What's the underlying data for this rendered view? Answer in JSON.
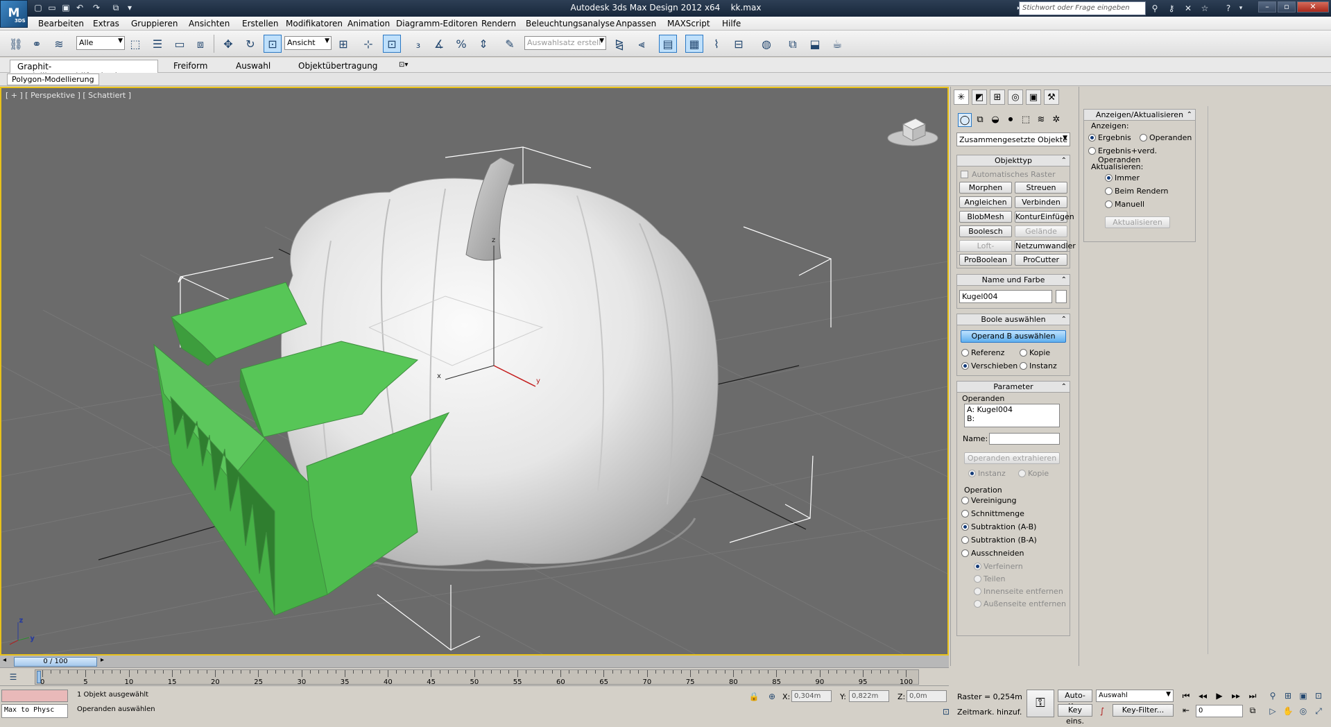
{
  "app": {
    "title": "Autodesk 3ds Max Design 2012 x64",
    "file": "kk.max",
    "logo_text": "M",
    "logo_sub": "3DS",
    "search_placeholder": "Stichwort oder Frage eingeben"
  },
  "menu": [
    "Bearbeiten",
    "Extras",
    "Gruppieren",
    "Ansichten",
    "Erstellen",
    "Modifikatoren",
    "Animation",
    "Diagramm-Editoren",
    "Beleuchtungsanalyse",
    "Rendern",
    "Anpassen",
    "MAXScript",
    "Hilfe"
  ],
  "toolbar": {
    "filter": "Alle",
    "refcoord": "Ansicht",
    "selset": "Auswahlsatz erstell"
  },
  "ribbon": {
    "tabs": [
      "Graphit-Modellierungshilfsmittel",
      "Freiform",
      "Auswahl",
      "Objektübertragung"
    ],
    "panel": "Polygon-Modellierung"
  },
  "viewport": {
    "label": "[ + ] [ Perspektive ] [ Schattiert ]",
    "axis_x": "x",
    "axis_y": "y",
    "axis_z": "z"
  },
  "cmd": {
    "category": "Zusammengesetzte Objekte",
    "objekttyp": {
      "title": "Objekttyp",
      "auto_grid": "Automatisches Raster",
      "buttons": [
        "Morphen",
        "Streuen",
        "Angleichen",
        "Verbinden",
        "BlobMesh",
        "KonturEinfügen",
        "Boolesch",
        "Gelände",
        "Loft-Extrusion",
        "Netzumwandler",
        "ProBoolean",
        "ProCutter"
      ]
    },
    "name_farbe": {
      "title": "Name und Farbe",
      "name": "Kugel004"
    },
    "boole": {
      "title": "Boole auswählen",
      "pick_button": "Operand B auswählen",
      "options": [
        "Referenz",
        "Kopie",
        "Verschieben",
        "Instanz"
      ]
    },
    "parameter": {
      "title": "Parameter",
      "operanden_label": "Operanden",
      "operand_a": "A: Kugel004",
      "operand_b": "B:",
      "name_label": "Name:",
      "extract_button": "Operanden extrahieren",
      "instanz": "Instanz",
      "kopie": "Kopie",
      "operation_label": "Operation",
      "operations": [
        "Vereinigung",
        "Schnittmenge",
        "Subtraktion (A-B)",
        "Subtraktion (B-A)",
        "Ausschneiden"
      ],
      "cut_options": [
        "Verfeinern",
        "Teilen",
        "Innenseite entfernen",
        "Außenseite entfernen"
      ]
    }
  },
  "display": {
    "title": "Anzeigen/Aktualisieren",
    "anzeigen": "Anzeigen:",
    "ergebnis": "Ergebnis",
    "operanden": "Operanden",
    "ergebnis_verd": "Ergebnis+verd. Operanden",
    "aktualisieren": "Aktualisieren:",
    "immer": "Immer",
    "beim_rendern": "Beim Rendern",
    "manuell": "Manuell",
    "update_button": "Aktualisieren"
  },
  "timeline": {
    "frame": "0 / 100",
    "ticks": [
      "0",
      "5",
      "10",
      "15",
      "20",
      "25",
      "30",
      "35",
      "40",
      "45",
      "50",
      "55",
      "60",
      "65",
      "70",
      "75",
      "80",
      "85",
      "90",
      "95",
      "100"
    ]
  },
  "status": {
    "maxscript": "Max to Physc",
    "selected": "1 Objekt ausgewählt",
    "prompt": "Operanden auswählen",
    "x_label": "X:",
    "x": "0,304m",
    "y_label": "Y:",
    "y": "0,822m",
    "z_label": "Z:",
    "z": "0,0m",
    "grid": "Raster = 0,254m",
    "timetag": "Zeitmark. hinzuf.",
    "autokey": "Auto-Key",
    "setkey": "Key eins.",
    "keymode": "Auswahl",
    "keyfilter": "Key-Filter...",
    "frame_field": "0"
  }
}
